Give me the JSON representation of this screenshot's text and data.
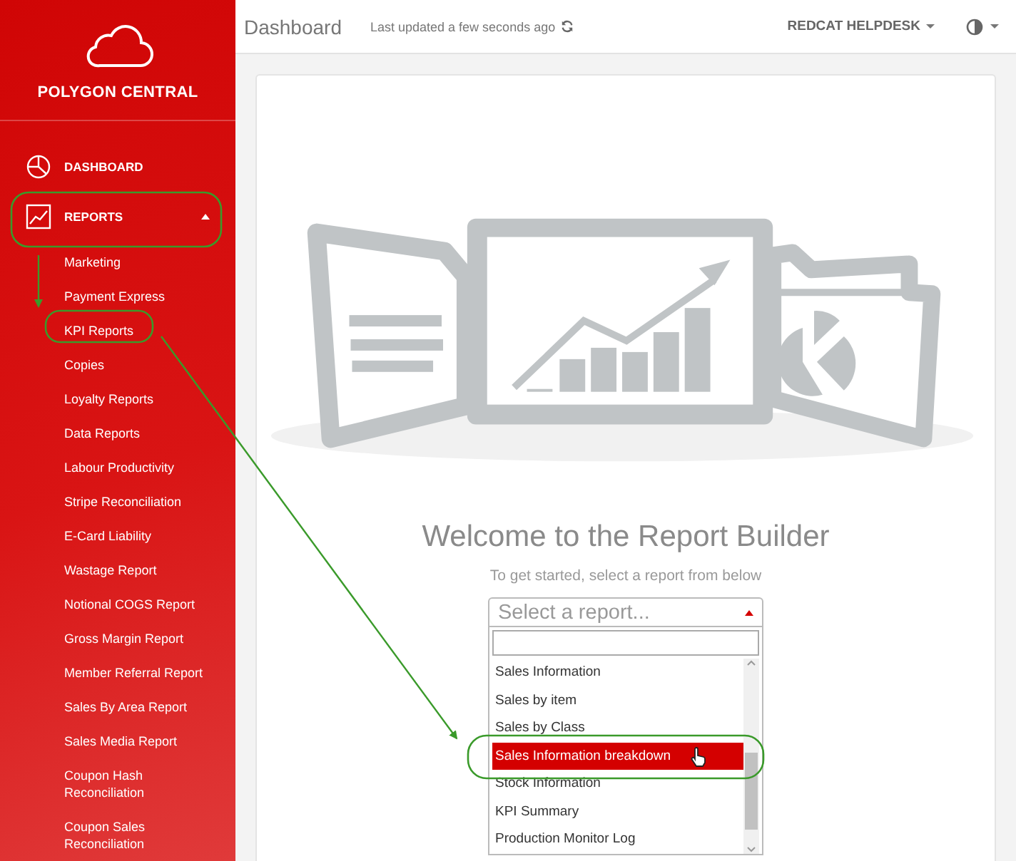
{
  "sidebar": {
    "brand": "POLYGON CENTRAL",
    "items": [
      {
        "label": "DASHBOARD",
        "kind": "pie"
      },
      {
        "label": "REPORTS",
        "kind": "chart",
        "expanded": true,
        "children": [
          {
            "label": "Marketing"
          },
          {
            "label": "Payment Express"
          },
          {
            "label": "KPI Reports"
          },
          {
            "label": "Copies"
          },
          {
            "label": "Loyalty Reports"
          },
          {
            "label": "Data Reports"
          },
          {
            "label": "Labour Productivity"
          },
          {
            "label": "Stripe Reconciliation"
          },
          {
            "label": "E-Card Liability"
          },
          {
            "label": "Wastage Report"
          },
          {
            "label": "Notional COGS Report"
          },
          {
            "label": "Gross Margin Report"
          },
          {
            "label": "Member Referral Report"
          },
          {
            "label": "Sales By Area Report"
          },
          {
            "label": "Sales Media Report"
          },
          {
            "label": "Coupon Hash Reconciliation"
          },
          {
            "label": "Coupon Sales Reconciliation"
          }
        ]
      }
    ]
  },
  "topbar": {
    "title": "Dashboard",
    "updated": "Last updated a few seconds ago",
    "user": "REDCAT HELPDESK"
  },
  "report_builder": {
    "heading": "Welcome to the Report Builder",
    "subtitle": "To get started, select a report from below",
    "select": {
      "placeholder": "Select a report...",
      "expanded": true
    },
    "options": [
      {
        "label": "Sales Information",
        "selected": false
      },
      {
        "label": "Sales by item",
        "selected": false
      },
      {
        "label": "Sales by Class",
        "selected": false
      },
      {
        "label": "Sales Information breakdown",
        "selected": true
      },
      {
        "label": "Stock Information",
        "selected": false
      },
      {
        "label": "KPI Summary",
        "selected": false
      },
      {
        "label": "Production Monitor Log",
        "selected": false
      }
    ]
  }
}
